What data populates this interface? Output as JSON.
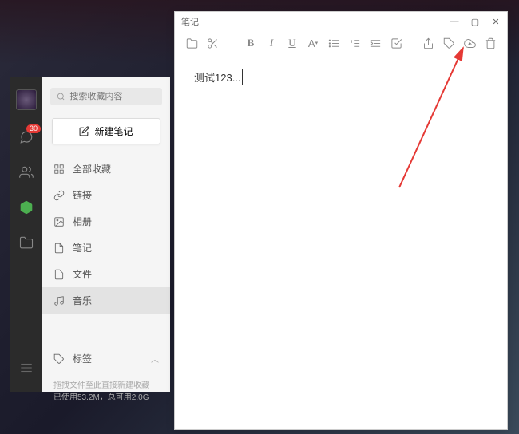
{
  "sidebar": {
    "badge_count": "30"
  },
  "nav": {
    "search_placeholder": "搜索收藏内容",
    "new_note_label": "新建笔记",
    "items": [
      {
        "label": "全部收藏"
      },
      {
        "label": "链接"
      },
      {
        "label": "相册"
      },
      {
        "label": "笔记"
      },
      {
        "label": "文件"
      },
      {
        "label": "音乐"
      }
    ],
    "tags_label": "标签",
    "footer_line1": "拖拽文件至此直接新建收藏",
    "footer_line2": "已使用53.2M，总可用2.0G"
  },
  "editor": {
    "title": "笔记",
    "content": "测试123..."
  },
  "annotation": {
    "arrow_color": "#e53935"
  }
}
